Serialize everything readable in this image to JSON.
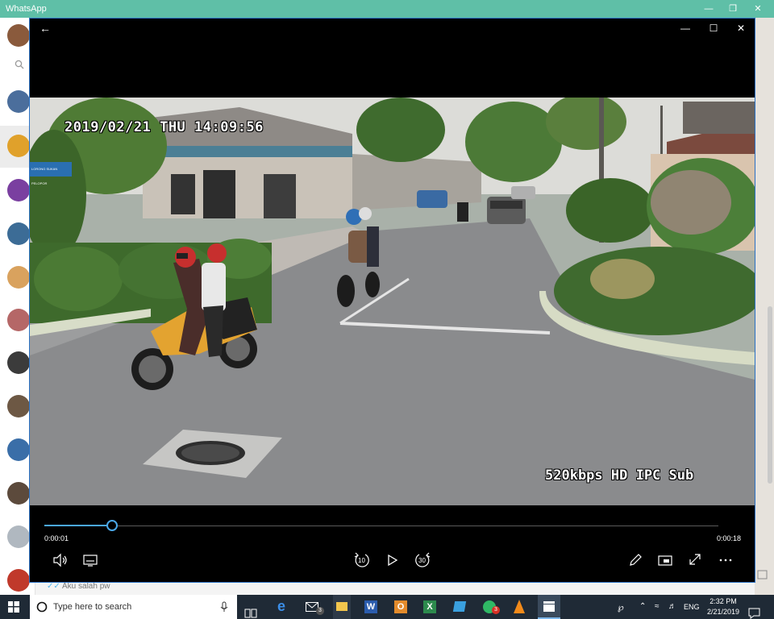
{
  "whatsapp": {
    "title": "WhatsApp",
    "last_message": "Aku salah pw"
  },
  "player": {
    "timestamp_overlay": "2019/02/21 THU 14:09:56",
    "stream_overlay": "520kbps HD IPC Sub",
    "elapsed": "0:00:01",
    "remaining": "0:00:18",
    "progress_fraction": 0.1,
    "skip_back_label": "10",
    "skip_forward_label": "30",
    "street_sign": "LORONG SUKAN PELOPOR"
  },
  "taskbar": {
    "search_placeholder": "Type here to search",
    "mail_badge": "3",
    "whatsapp_badge": "3",
    "keyboard_language": "ENG",
    "clock_time": "2:32 PM",
    "clock_date": "2/21/2019"
  },
  "colors": {
    "accent": "#4aa7e8",
    "whatsapp_titlebar": "#5fbfa7",
    "taskbar": "#1f2a36"
  }
}
